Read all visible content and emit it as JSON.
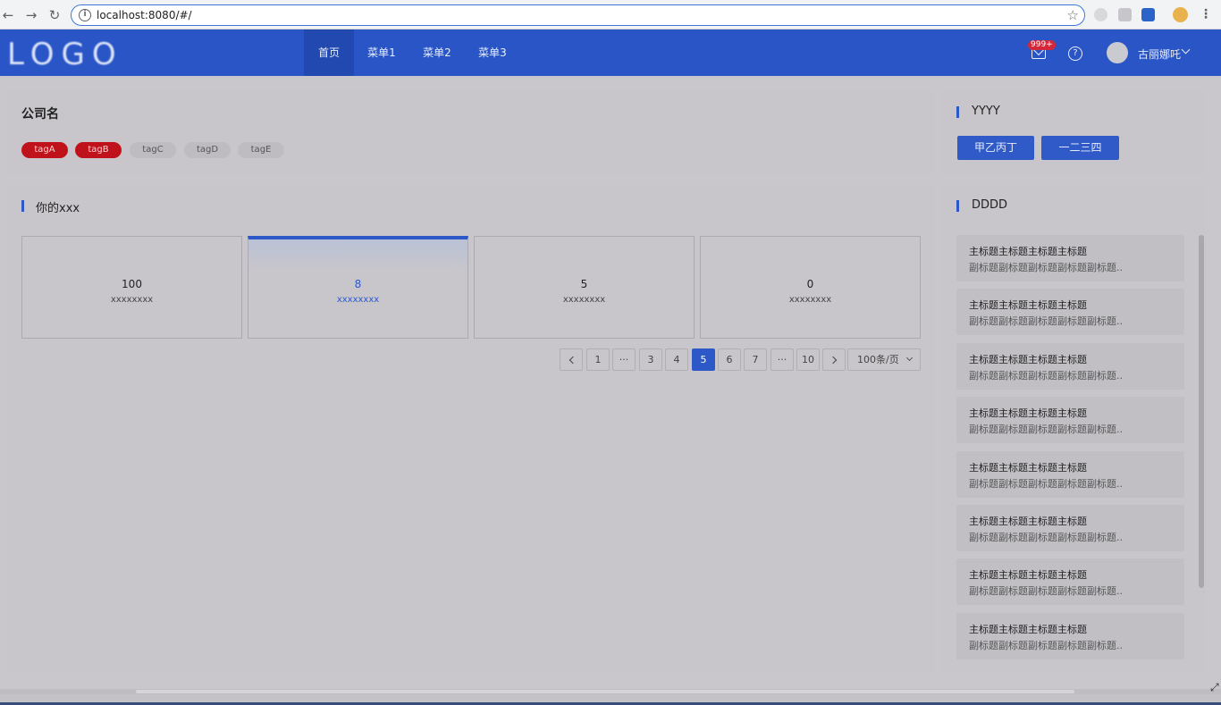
{
  "browser": {
    "url": "localhost:8080/#/",
    "back_icon": "arrow-left-icon",
    "forward_icon": "arrow-right-icon",
    "reload_icon": "reload-icon"
  },
  "header": {
    "logo_text": "LOGO",
    "nav": [
      "首页",
      "菜单1",
      "菜单2",
      "菜单3"
    ],
    "active_nav": "首页",
    "mail_badge": "999+",
    "user_name": "古丽娜吒",
    "brand_color": "#2955c7"
  },
  "company": {
    "name": "公司名",
    "tags": [
      "tagA",
      "tagB",
      "tagC",
      "tagD",
      "tagE"
    ],
    "highlighted_tags": [
      "tagA",
      "tagB"
    ]
  },
  "yyyy": {
    "title": "YYYY",
    "buttons": [
      "甲乙丙丁",
      "一二三四"
    ]
  },
  "stats": {
    "title": "你的xxx",
    "cards": [
      {
        "value": "100",
        "label": "xxxxxxxx"
      },
      {
        "value": "8",
        "label": "xxxxxxxx"
      },
      {
        "value": "5",
        "label": "xxxxxxxx"
      },
      {
        "value": "0",
        "label": "xxxxxxxx"
      }
    ],
    "active_card": 1
  },
  "pagination": {
    "pages": [
      "1",
      "···",
      "3",
      "4",
      "5",
      "6",
      "7",
      "···",
      "10"
    ],
    "current": "5",
    "page_size": "100条/页"
  },
  "dddd": {
    "title": "DDDD",
    "items": [
      {
        "title": "主标题主标题主标题主标题",
        "subtitle": "副标题副标题副标题副标题副标题.."
      },
      {
        "title": "主标题主标题主标题主标题",
        "subtitle": "副标题副标题副标题副标题副标题.."
      },
      {
        "title": "主标题主标题主标题主标题",
        "subtitle": "副标题副标题副标题副标题副标题.."
      },
      {
        "title": "主标题主标题主标题主标题",
        "subtitle": "副标题副标题副标题副标题副标题.."
      },
      {
        "title": "主标题主标题主标题主标题",
        "subtitle": "副标题副标题副标题副标题副标题.."
      },
      {
        "title": "主标题主标题主标题主标题",
        "subtitle": "副标题副标题副标题副标题副标题.."
      },
      {
        "title": "主标题主标题主标题主标题",
        "subtitle": "副标题副标题副标题副标题副标题.."
      },
      {
        "title": "主标题主标题主标题主标题",
        "subtitle": "副标题副标题副标题副标题副标题.."
      }
    ]
  }
}
